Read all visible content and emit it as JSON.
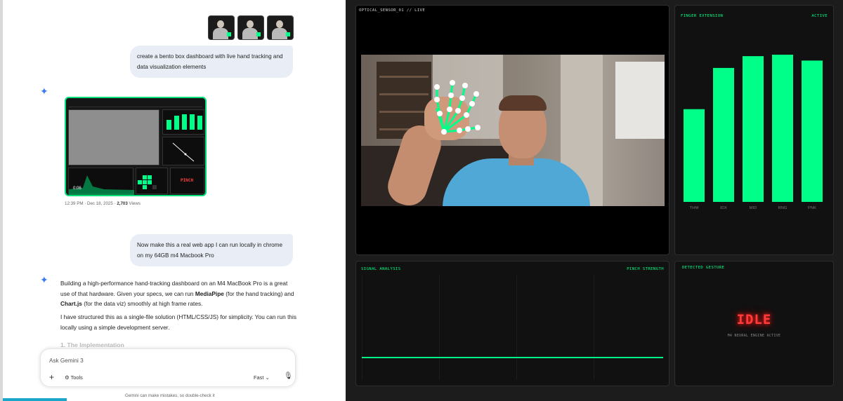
{
  "chat": {
    "user_message_1": "create a bento box dashboard with live hand tracking and data visualization elements",
    "image_meta_time": "12:39 PM · Dec 18, 2025 ·",
    "image_meta_views": "2,703",
    "image_meta_suffix": "Views",
    "image_preview": {
      "pinch_label": "PINCH",
      "timer": "0:06"
    },
    "user_message_2": "Now make this a real web app I can run locally in chrome on my 64GB m4 Macbook Pro",
    "answer": {
      "p1_a": "Building a high-performance hand-tracking dashboard on an M4 MacBook Pro is a great use of that hardware. Given your specs, we can run ",
      "p1_b": "MediaPipe",
      "p1_c": " (for the hand tracking) and ",
      "p1_d": "Chart.js",
      "p1_e": " (for the data viz) smoothly at high frame rates.",
      "p2": "I have structured this as a single-file solution (HTML/CSS/JS) for simplicity. You can run this locally using a simple development server.",
      "heading": "1. The Implementation"
    },
    "input": {
      "placeholder": "Ask Gemini 3",
      "tools_label": "Tools",
      "mode_label": "Fast",
      "plus_icon": "+",
      "mic_icon": "🎙",
      "chevron": "⌄"
    },
    "disclaimer": "Gemini can make mistakes, so double-check it",
    "sparkle_glyph": "✦"
  },
  "dashboard": {
    "camera": {
      "label": "OPTICAL_SENSOR_01 // LIVE"
    },
    "finger_extension": {
      "title": "FINGER EXTENSION",
      "status": "ACTIVE"
    },
    "signal": {
      "title": "SIGNAL ANALYSIS",
      "right_label": "PINCH STRENGTH"
    },
    "gesture": {
      "title": "DETECTED GESTURE",
      "value": "IDLE",
      "engine": "M4 NEURAL ENGINE ACTIVE"
    },
    "colors": {
      "accent": "#00ff88",
      "alert": "#ff3b3b",
      "panel": "#111111"
    }
  },
  "chart_data": {
    "type": "bar",
    "categories": [
      "THM",
      "IDX",
      "MID",
      "RNG",
      "PNK"
    ],
    "values": [
      0.63,
      0.91,
      0.99,
      1.0,
      0.96
    ],
    "ylim": [
      0,
      1
    ],
    "title": "FINGER EXTENSION",
    "xlabel": "",
    "ylabel": "",
    "grid": false
  }
}
